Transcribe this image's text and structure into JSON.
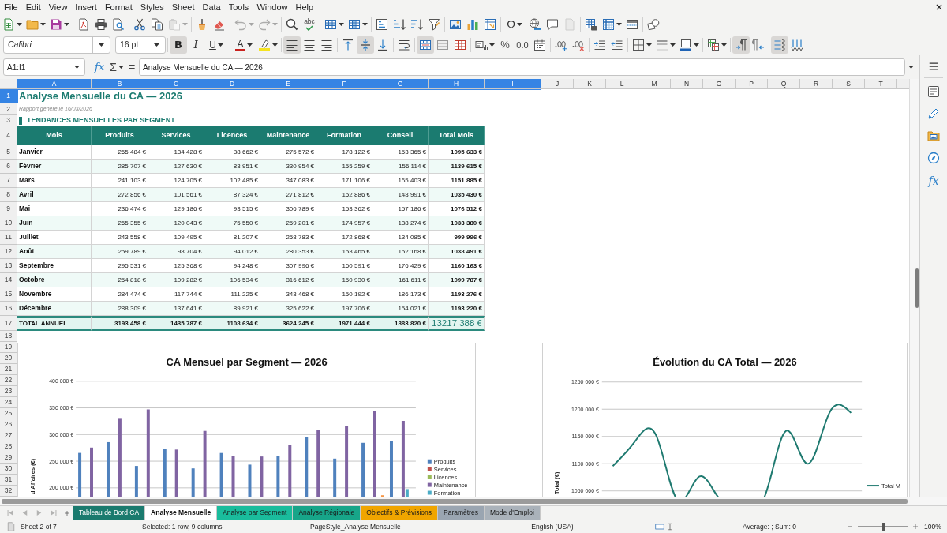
{
  "menu_bar": {
    "items": [
      "File",
      "Edit",
      "View",
      "Insert",
      "Format",
      "Styles",
      "Sheet",
      "Data",
      "Tools",
      "Window",
      "Help"
    ]
  },
  "standard_toolbar": {
    "buttons": [
      {
        "disabled": false
      },
      {
        "disabled": false
      },
      {
        "disabled": false
      },
      {
        "disabled": false
      },
      {
        "disabled": false
      },
      {
        "disabled": false
      },
      {
        "disabled": false
      },
      {
        "disabled": false
      },
      {
        "disabled": true
      },
      {
        "disabled": false
      },
      {
        "disabled": false
      },
      {
        "disabled": true
      },
      {
        "disabled": true
      },
      {
        "disabled": false
      },
      {
        "glyph": "abc",
        "disabled": false
      },
      {
        "disabled": false
      },
      {
        "disabled": false
      },
      {
        "disabled": false
      },
      {
        "disabled": false
      },
      {
        "disabled": false
      },
      {
        "disabled": false
      },
      {
        "disabled": false
      },
      {
        "disabled": false
      },
      {
        "disabled": false
      },
      {
        "glyph": "Ω",
        "disabled": false
      },
      {
        "disabled": false
      },
      {
        "disabled": false
      },
      {
        "disabled": true
      },
      {
        "disabled": false
      },
      {
        "disabled": false
      },
      {
        "disabled": false
      },
      {
        "disabled": false
      }
    ]
  },
  "formatting_toolbar": {
    "font_name": "Calibri",
    "font_size": "16 pt",
    "buttons": [
      {
        "glyph": "B",
        "pressed": true
      },
      {
        "glyph": "I",
        "pressed": false
      },
      {
        "glyph": "U",
        "pressed": false
      },
      {
        "glyph": "A",
        "pressed": false
      },
      {
        "pressed": false
      },
      {
        "pressed": true
      },
      {
        "pressed": false
      },
      {
        "pressed": false
      },
      {
        "pressed": false
      },
      {
        "pressed": true
      },
      {
        "pressed": false
      },
      {
        "pressed": false
      },
      {
        "pressed": true
      },
      {
        "pressed": false
      },
      {
        "pressed": false
      },
      {
        "pressed": false
      },
      {
        "glyph": "%",
        "pressed": false
      },
      {
        "glyph": "0.0",
        "pressed": false
      },
      {
        "pressed": false
      },
      {
        "pressed": false
      },
      {
        "pressed": false
      },
      {
        "pressed": false
      },
      {
        "pressed": false
      },
      {
        "pressed": false
      },
      {
        "pressed": false
      },
      {
        "pressed": false
      },
      {
        "pressed": false
      },
      {
        "pressed": true
      },
      {
        "pressed": false
      },
      {
        "pressed": true
      },
      {
        "pressed": false
      }
    ]
  },
  "formula_bar": {
    "name_box": "A1:I1",
    "function_glyph": "fx",
    "sum_glyph": "Σ",
    "equals_glyph": "=",
    "content": "Analyse Mensuelle du CA — 2026"
  },
  "sidebar": {
    "functions_glyph": "fx"
  },
  "sheet": {
    "columns": [
      {
        "label": "A",
        "selected": true
      },
      {
        "label": "B",
        "selected": true
      },
      {
        "label": "C",
        "selected": true
      },
      {
        "label": "D",
        "selected": true
      },
      {
        "label": "E",
        "selected": true
      },
      {
        "label": "F",
        "selected": true
      },
      {
        "label": "G",
        "selected": true
      },
      {
        "label": "H",
        "selected": true
      },
      {
        "label": "I",
        "selected": true
      },
      {
        "label": "J",
        "selected": false
      },
      {
        "label": "K",
        "selected": false
      },
      {
        "label": "L",
        "selected": false
      },
      {
        "label": "M",
        "selected": false
      },
      {
        "label": "N",
        "selected": false
      },
      {
        "label": "O",
        "selected": false
      },
      {
        "label": "P",
        "selected": false
      },
      {
        "label": "Q",
        "selected": false
      },
      {
        "label": "R",
        "selected": false
      },
      {
        "label": "S",
        "selected": false
      },
      {
        "label": "T",
        "selected": false
      }
    ],
    "rows": [
      {
        "label": "1",
        "selected": true
      },
      {
        "label": "2",
        "selected": false
      },
      {
        "label": "3",
        "selected": false
      },
      {
        "label": "4",
        "selected": false
      },
      {
        "label": "5",
        "selected": false
      },
      {
        "label": "6",
        "selected": false
      },
      {
        "label": "7",
        "selected": false
      },
      {
        "label": "8",
        "selected": false
      },
      {
        "label": "9",
        "selected": false
      },
      {
        "label": "10",
        "selected": false
      },
      {
        "label": "11",
        "selected": false
      },
      {
        "label": "12",
        "selected": false
      },
      {
        "label": "13",
        "selected": false
      },
      {
        "label": "14",
        "selected": false
      },
      {
        "label": "15",
        "selected": false
      },
      {
        "label": "16",
        "selected": false
      },
      {
        "label": "17",
        "selected": false
      },
      {
        "label": "18",
        "selected": false
      },
      {
        "label": "19",
        "selected": false
      },
      {
        "label": "20",
        "selected": false
      },
      {
        "label": "21",
        "selected": false
      },
      {
        "label": "22",
        "selected": false
      },
      {
        "label": "23",
        "selected": false
      },
      {
        "label": "24",
        "selected": false
      },
      {
        "label": "25",
        "selected": false
      },
      {
        "label": "26",
        "selected": false
      },
      {
        "label": "27",
        "selected": false
      },
      {
        "label": "28",
        "selected": false
      },
      {
        "label": "29",
        "selected": false
      },
      {
        "label": "30",
        "selected": false
      },
      {
        "label": "31",
        "selected": false
      },
      {
        "label": "32",
        "selected": false
      }
    ]
  },
  "cells": {
    "title": "Analyse Mensuelle du CA — 2026",
    "generated": "Rapport généré le 16/03/2026",
    "section": "TENDANCES MENSUELLES PAR SEGMENT",
    "table": {
      "columns": [
        "Mois",
        "Produits",
        "Services",
        "Licences",
        "Maintenance",
        "Formation",
        "Conseil",
        "Total Mois"
      ],
      "rows": [
        [
          "Janvier",
          "265 484 €",
          "134 428 €",
          "88 662 €",
          "275 572 €",
          "178 122 €",
          "153 365 €",
          "1095 633 €"
        ],
        [
          "Février",
          "285 707 €",
          "127 630 €",
          "83 951 €",
          "330 954 €",
          "155 259 €",
          "156 114 €",
          "1139 615 €"
        ],
        [
          "Mars",
          "241 103 €",
          "124 705 €",
          "102 485 €",
          "347 083 €",
          "171 106 €",
          "165 403 €",
          "1151 885 €"
        ],
        [
          "Avril",
          "272 856 €",
          "101 561 €",
          "87 324 €",
          "271 812 €",
          "152 886 €",
          "148 991 €",
          "1035 430 €"
        ],
        [
          "Mai",
          "236 474 €",
          "129 186 €",
          "93 515 €",
          "306 789 €",
          "153 362 €",
          "157 186 €",
          "1076 512 €"
        ],
        [
          "Juin",
          "265 355 €",
          "120 043 €",
          "75 550 €",
          "259 201 €",
          "174 957 €",
          "138 274 €",
          "1033 380 €"
        ],
        [
          "Juillet",
          "243 558 €",
          "109 495 €",
          "81 207 €",
          "258 783 €",
          "172 868 €",
          "134 085 €",
          "999 996 €"
        ],
        [
          "Août",
          "259 789 €",
          "98 704 €",
          "94 012 €",
          "280 353 €",
          "153 465 €",
          "152 168 €",
          "1038 491 €"
        ],
        [
          "Septembre",
          "295 531 €",
          "125 368 €",
          "94 248 €",
          "307 996 €",
          "160 591 €",
          "176 429 €",
          "1160 163 €"
        ],
        [
          "Octobre",
          "254 818 €",
          "109 282 €",
          "106 534 €",
          "316 612 €",
          "150 930 €",
          "161 611 €",
          "1099 787 €"
        ],
        [
          "Novembre",
          "284 474 €",
          "117 744 €",
          "111 225 €",
          "343 468 €",
          "150 192 €",
          "186 173 €",
          "1193 276 €"
        ],
        [
          "Décembre",
          "288 309 €",
          "137 641 €",
          "89 921 €",
          "325 622 €",
          "197 706 €",
          "154 021 €",
          "1193 220 €"
        ]
      ],
      "total": [
        "TOTAL ANNUEL",
        "3193 458 €",
        "1435 787 €",
        "1108 634 €",
        "3624 245 €",
        "1971 444 €",
        "1883 820 €",
        "13217 388 €"
      ]
    }
  },
  "charts": [
    {
      "chart_data": {
        "type": "bar",
        "title": "CA Mensuel par Segment — 2026",
        "ylabel": "d'Affaires (€)",
        "legend": "right",
        "grid": true,
        "categories": [
          null,
          null,
          null,
          null,
          null,
          null,
          null,
          null,
          null,
          null,
          null,
          null
        ],
        "ylim": [
          182000,
          400000
        ],
        "yticks": [
          {
            "value": 200000,
            "label": "200 000 €"
          },
          {
            "value": 250000,
            "label": "250 000 €"
          },
          {
            "value": 300000,
            "label": "300 000 €"
          },
          {
            "value": 350000,
            "label": "350 000 €"
          },
          {
            "value": 400000,
            "label": "400 000 €"
          }
        ],
        "series": [
          {
            "name": "Produits",
            "color": "#4f81bd",
            "values": [
              265484,
              285707,
              241103,
              272856,
              236474,
              265355,
              243558,
              259789,
              295531,
              254818,
              284474,
              288309
            ]
          },
          {
            "name": "Services",
            "color": "#c0504d",
            "values": [
              null,
              null,
              null,
              null,
              null,
              null,
              null,
              null,
              null,
              null,
              null,
              null
            ]
          },
          {
            "name": "Licences",
            "color": "#9bbb59",
            "values": [
              null,
              null,
              null,
              null,
              null,
              null,
              null,
              null,
              null,
              null,
              null,
              null
            ]
          },
          {
            "name": "Maintenance",
            "color": "#8064a2",
            "values": [
              275572,
              330954,
              347083,
              271812,
              306789,
              259201,
              258783,
              280353,
              307996,
              316612,
              343468,
              325622
            ]
          },
          {
            "name": "Formation",
            "color": "#4bacc6",
            "values": [
              null,
              null,
              null,
              null,
              null,
              null,
              null,
              null,
              null,
              null,
              null,
              197706
            ]
          },
          {
            "color": "#f79646",
            "values": [
              null,
              null,
              null,
              null,
              null,
              null,
              null,
              null,
              null,
              null,
              186173,
              null
            ]
          }
        ]
      }
    },
    {
      "chart_data": {
        "type": "line",
        "title": "Évolution du CA Total — 2026",
        "ylabel": "Total (€)",
        "legend": "right",
        "grid": true,
        "categories": [
          null,
          null,
          null,
          null,
          null,
          null,
          null,
          null,
          null,
          null,
          null,
          null
        ],
        "ylim": [
          1038000,
          1250000
        ],
        "yticks": [
          {
            "value": 1050000,
            "label": "1050 000 €"
          },
          {
            "value": 1100000,
            "label": "1100 000 €"
          },
          {
            "value": 1150000,
            "label": "1150 000 €"
          },
          {
            "value": 1200000,
            "label": "1200 000 €"
          },
          {
            "value": 1250000,
            "label": "1250 000 €"
          }
        ],
        "series": [
          {
            "name": "Total M",
            "color": "#1f7a70",
            "values": [
              1095633,
              1139615,
              1151885,
              null,
              1076512,
              null,
              null,
              1038491,
              1160163,
              1099787,
              1193276,
              1193220
            ]
          }
        ]
      }
    }
  ],
  "sheet_nav": [
    {
      "disabled": true
    },
    {
      "disabled": true
    },
    {
      "disabled": true
    },
    {
      "disabled": true
    }
  ],
  "sheet_tabs": [
    {
      "label": "Tableau de Bord CA",
      "selected": false,
      "color": "#1a7a6e"
    },
    {
      "label": "Analyse Mensuelle",
      "selected": true
    },
    {
      "label": "Analyse par Segment",
      "selected": false,
      "color": "#1abc9c"
    },
    {
      "label": "Analyse Régionale",
      "selected": false,
      "color": "#17a589"
    },
    {
      "label": "Objectifs & Prévisions",
      "selected": false,
      "color": "#f0a500"
    },
    {
      "label": "Paramètres",
      "selected": false,
      "color": "#9aa5b1"
    },
    {
      "label": "Mode d'Emploi",
      "selected": false,
      "color": "#aab2ba"
    }
  ],
  "status_bar": {
    "sheet": "Sheet 2 of 7",
    "selection": "Selected: 1 row, 9 columns",
    "page_style": "PageStyle_Analyse Mensuelle",
    "language": "English (USA)",
    "summary": "Average: ; Sum: 0",
    "zoom": {
      "level": 0.5,
      "reading": "100%"
    }
  }
}
